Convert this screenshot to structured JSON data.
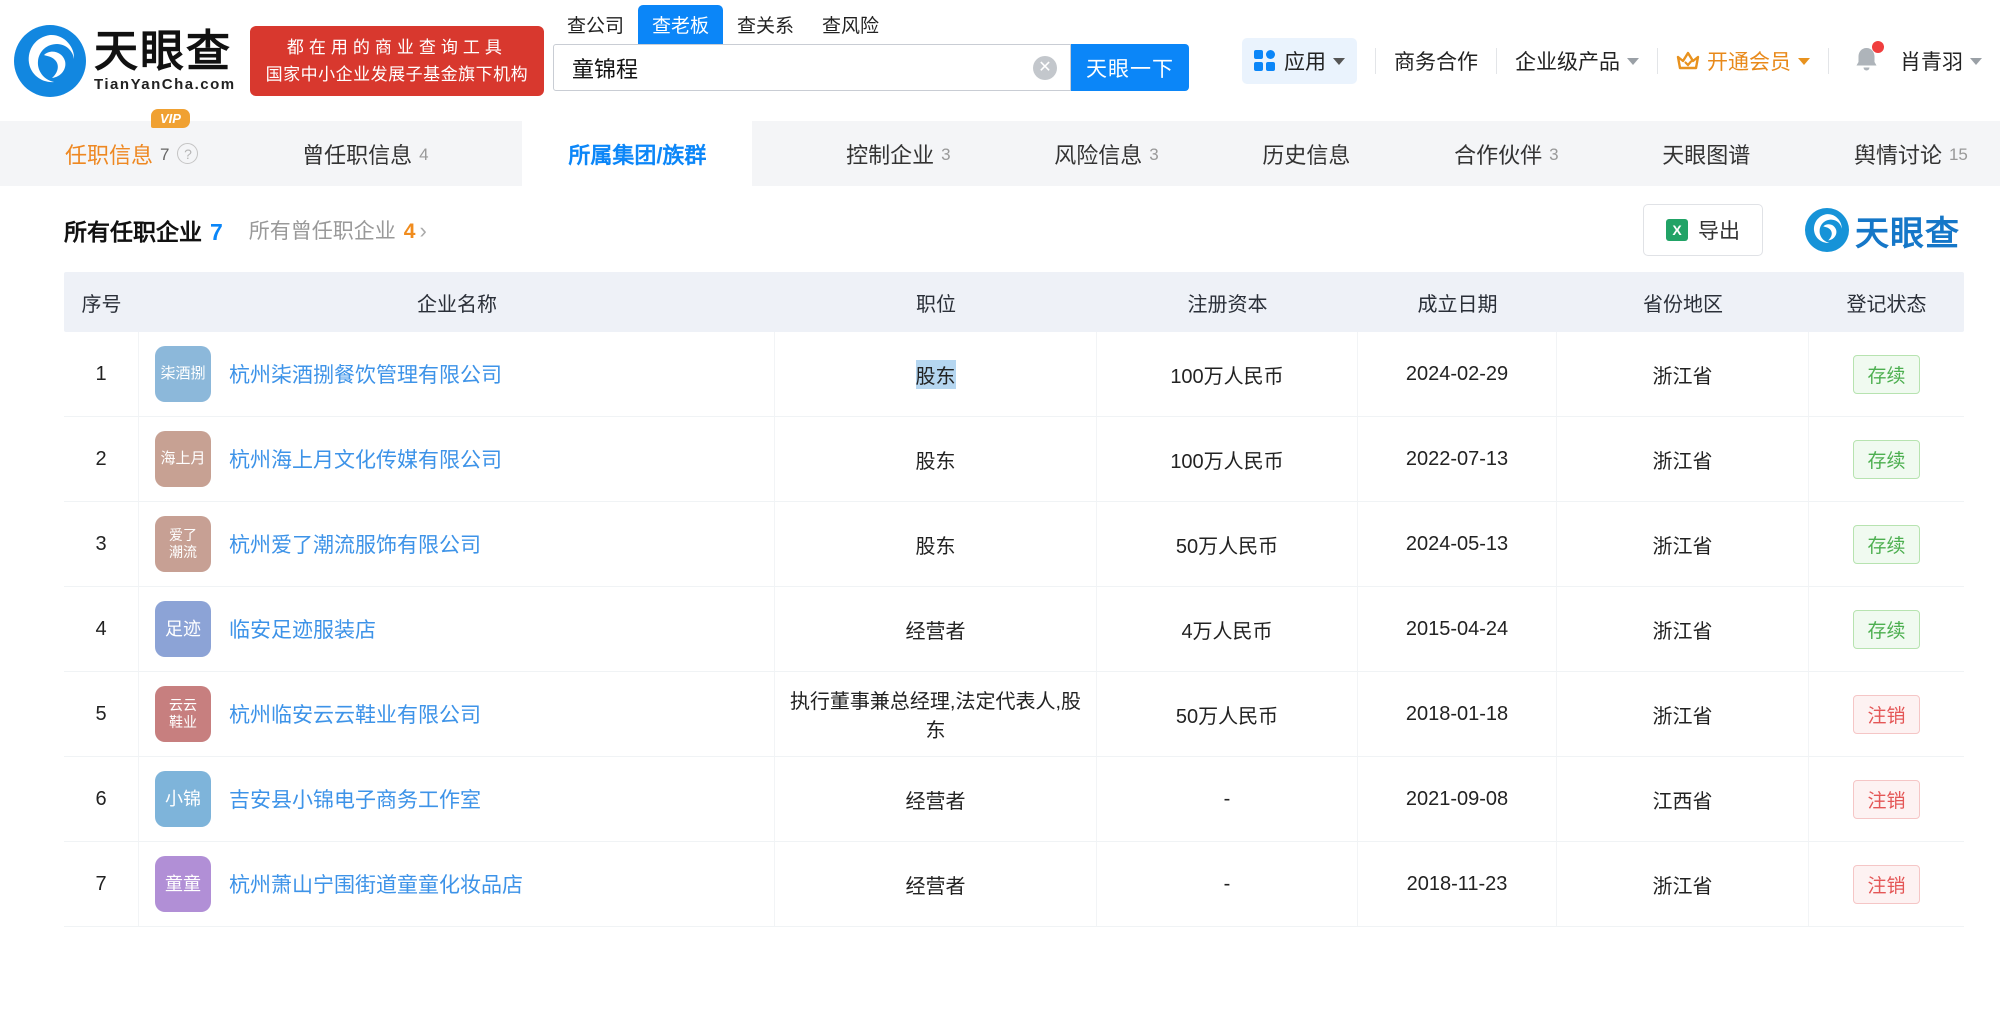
{
  "brand": {
    "name_cn": "天眼查",
    "name_en": "TianYanCha.com",
    "banner_line1": "都在用的商业查询工具",
    "banner_line2": "国家中小企业发展子基金旗下机构",
    "banner_color": "#d8382e",
    "primary_blue": "#0b86f8",
    "watermark_text": "天眼查"
  },
  "search": {
    "tabs": [
      {
        "label": "查公司",
        "active": false
      },
      {
        "label": "查老板",
        "active": true
      },
      {
        "label": "查关系",
        "active": false
      },
      {
        "label": "查风险",
        "active": false
      }
    ],
    "query": "童锦程",
    "button_label": "天眼一下",
    "clear_icon": "close-circle-icon"
  },
  "topnav": {
    "apps_label": "应用",
    "items": [
      "商务合作",
      "企业级产品"
    ],
    "vip_label": "开通会员",
    "vip_color": "#e8891a",
    "bell_icon": "bell-icon",
    "bell_has_red_dot": true,
    "username": "肖青羽"
  },
  "page_tabs": [
    {
      "label": "任职信息",
      "count": "7",
      "orange": true,
      "vip": "VIP",
      "help": true,
      "active": false
    },
    {
      "label": "曾任职信息",
      "count": "4",
      "active": false
    },
    {
      "label": "所属集团/族群",
      "count": "",
      "active": true
    },
    {
      "label": "控制企业",
      "count": "3",
      "active": false
    },
    {
      "label": "风险信息",
      "count": "3",
      "active": false
    },
    {
      "label": "历史信息",
      "count": "",
      "active": false
    },
    {
      "label": "合作伙伴",
      "count": "3",
      "active": false
    },
    {
      "label": "天眼图谱",
      "count": "",
      "active": false
    },
    {
      "label": "舆情讨论",
      "count": "15",
      "active": false
    }
  ],
  "subheader": {
    "title": "所有任职企业",
    "title_count": "7",
    "secondary": "所有曾任职企业",
    "secondary_count": "4",
    "chevron": "›",
    "export_label": "导出",
    "export_icon": "excel-icon"
  },
  "table": {
    "columns": [
      "序号",
      "企业名称",
      "职位",
      "注册资本",
      "成立日期",
      "省份地区",
      "登记状态"
    ],
    "rows": [
      {
        "seq": "1",
        "avatar_lines": [
          "柒酒捌"
        ],
        "avatar_color": "#8cb8da",
        "company": "杭州柒酒捌餐饮管理有限公司",
        "position": "股东",
        "position_highlighted": true,
        "capital": "100万人民币",
        "date": "2024-02-29",
        "province": "浙江省",
        "status": "存续",
        "status_type": "active"
      },
      {
        "seq": "2",
        "avatar_lines": [
          "海上月"
        ],
        "avatar_color": "#c7a193",
        "company": "杭州海上月文化传媒有限公司",
        "position": "股东",
        "position_highlighted": false,
        "capital": "100万人民币",
        "date": "2022-07-13",
        "province": "浙江省",
        "status": "存续",
        "status_type": "active"
      },
      {
        "seq": "3",
        "avatar_lines": [
          "爱了",
          "潮流"
        ],
        "avatar_color": "#c7a094",
        "company": "杭州爱了潮流服饰有限公司",
        "position": "股东",
        "position_highlighted": false,
        "capital": "50万人民币",
        "date": "2024-05-13",
        "province": "浙江省",
        "status": "存续",
        "status_type": "active"
      },
      {
        "seq": "4",
        "avatar_lines": [
          "足迹"
        ],
        "avatar_color": "#8ca3d6",
        "company": "临安足迹服装店",
        "position": "经营者",
        "position_highlighted": false,
        "capital": "4万人民币",
        "date": "2015-04-24",
        "province": "浙江省",
        "status": "存续",
        "status_type": "active"
      },
      {
        "seq": "5",
        "avatar_lines": [
          "云云",
          "鞋业"
        ],
        "avatar_color": "#c77f7f",
        "company": "杭州临安云云鞋业有限公司",
        "position": "执行董事兼总经理,法定代表人,股东",
        "position_highlighted": false,
        "capital": "50万人民币",
        "date": "2018-01-18",
        "province": "浙江省",
        "status": "注销",
        "status_type": "cancelled"
      },
      {
        "seq": "6",
        "avatar_lines": [
          "小锦"
        ],
        "avatar_color": "#7eb4da",
        "company": "吉安县小锦电子商务工作室",
        "position": "经营者",
        "position_highlighted": false,
        "capital": "-",
        "date": "2021-09-08",
        "province": "江西省",
        "status": "注销",
        "status_type": "cancelled"
      },
      {
        "seq": "7",
        "avatar_lines": [
          "童童"
        ],
        "avatar_color": "#b18fd6",
        "company": "杭州萧山宁围街道童童化妆品店",
        "position": "经营者",
        "position_highlighted": false,
        "capital": "-",
        "date": "2018-11-23",
        "province": "浙江省",
        "status": "注销",
        "status_type": "cancelled"
      }
    ]
  }
}
